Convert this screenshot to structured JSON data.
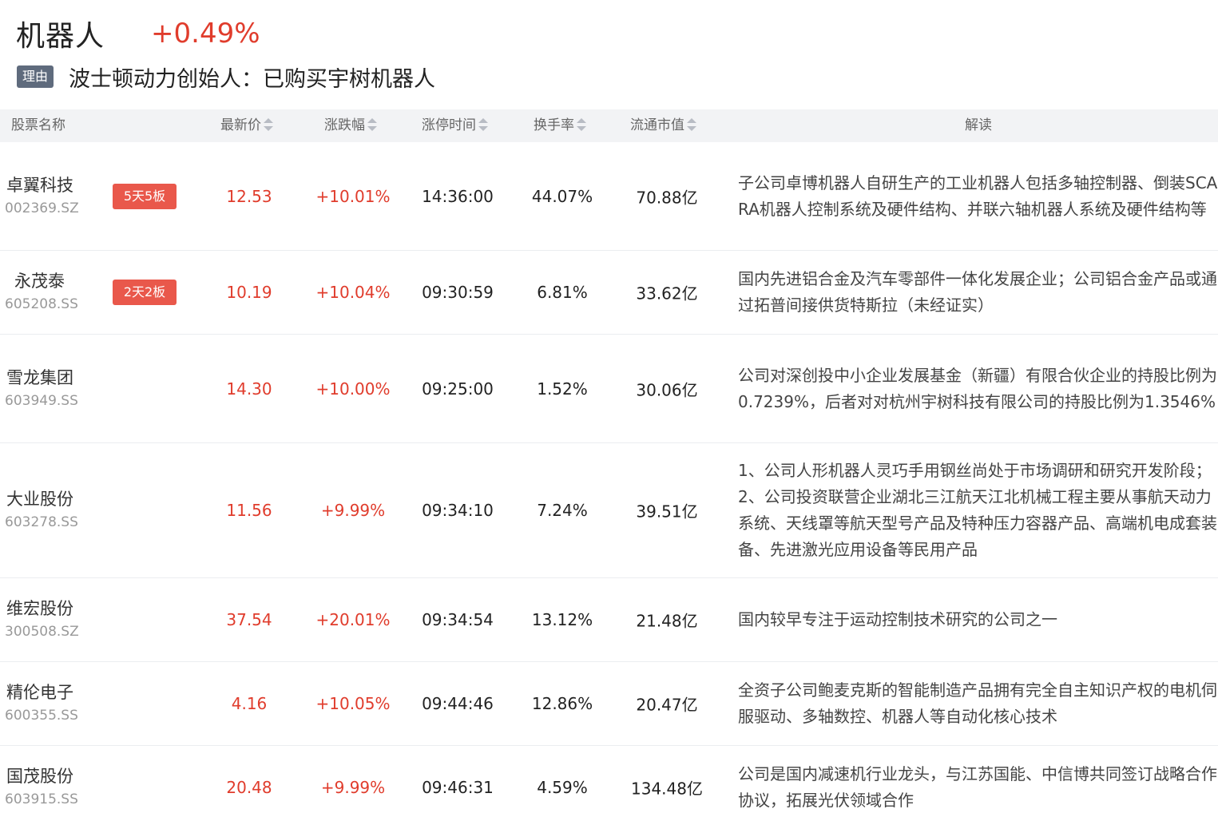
{
  "header": {
    "sector_name": "机器人",
    "sector_change": "+0.49%",
    "reason_tag": "理由",
    "reason_text": "波士顿动力创始人：已购买宇树机器人"
  },
  "table": {
    "columns": [
      "股票名称",
      "最新价",
      "涨跌幅",
      "涨停时间",
      "换手率",
      "流通市值",
      "解读"
    ],
    "rows": [
      {
        "name": "卓翼科技",
        "code": "002369.SZ",
        "badge": "5天5板",
        "price": "12.53",
        "change": "+10.01%",
        "limit_time": "14:36:00",
        "turnover": "44.07%",
        "float_cap": "70.88亿",
        "desc": "子公司卓博机器人自研生产的工业机器人包括多轴控制器、倒装SCARA机器人控制系统及硬件结构、并联六轴机器人系统及硬件结构等"
      },
      {
        "name": "永茂泰",
        "code": "605208.SS",
        "badge": "2天2板",
        "price": "10.19",
        "change": "+10.04%",
        "limit_time": "09:30:59",
        "turnover": "6.81%",
        "float_cap": "33.62亿",
        "desc": "国内先进铝合金及汽车零部件一体化发展企业；公司铝合金产品或通过拓普间接供货特斯拉（未经证实）"
      },
      {
        "name": "雪龙集团",
        "code": "603949.SS",
        "badge": "",
        "price": "14.30",
        "change": "+10.00%",
        "limit_time": "09:25:00",
        "turnover": "1.52%",
        "float_cap": "30.06亿",
        "desc": "公司对深创投中小企业发展基金（新疆）有限合伙企业的持股比例为0.7239%，后者对对杭州宇树科技有限公司的持股比例为1.3546%"
      },
      {
        "name": "大业股份",
        "code": "603278.SS",
        "badge": "",
        "price": "11.56",
        "change": "+9.99%",
        "limit_time": "09:34:10",
        "turnover": "7.24%",
        "float_cap": "39.51亿",
        "desc": "1、公司人形机器人灵巧手用钢丝尚处于市场调研和研究开发阶段； 2、公司投资联营企业湖北三江航天江北机械工程主要从事航天动力系统、天线罩等航天型号产品及特种压力容器产品、高端机电成套装备、先进激光应用设备等民用产品"
      },
      {
        "name": "维宏股份",
        "code": "300508.SZ",
        "badge": "",
        "price": "37.54",
        "change": "+20.01%",
        "limit_time": "09:34:54",
        "turnover": "13.12%",
        "float_cap": "21.48亿",
        "desc": "国内较早专注于运动控制技术研究的公司之一"
      },
      {
        "name": "精伦电子",
        "code": "600355.SS",
        "badge": "",
        "price": "4.16",
        "change": "+10.05%",
        "limit_time": "09:44:46",
        "turnover": "12.86%",
        "float_cap": "20.47亿",
        "desc": "全资子公司鲍麦克斯的智能制造产品拥有完全自主知识产权的电机伺服驱动、多轴数控、机器人等自动化核心技术"
      },
      {
        "name": "国茂股份",
        "code": "603915.SS",
        "badge": "",
        "price": "20.48",
        "change": "+9.99%",
        "limit_time": "09:46:31",
        "turnover": "4.59%",
        "float_cap": "134.48亿",
        "desc": "公司是国内减速机行业龙头，与江苏国能、中信博共同签订战略合作协议，拓展光伏领域合作"
      }
    ]
  },
  "colors": {
    "up_red": "#e03c2c",
    "badge_red": "#e9584b",
    "tag_gray": "#5f6b7d",
    "header_bg": "#f2f3f5"
  }
}
